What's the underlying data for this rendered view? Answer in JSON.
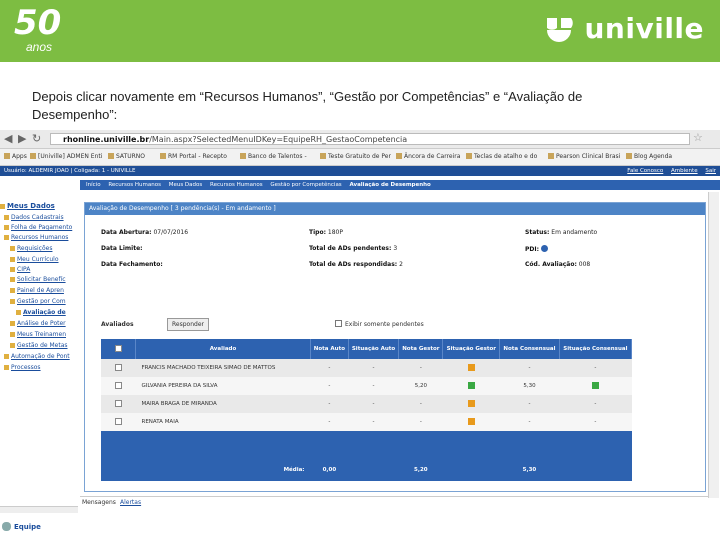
{
  "slide": {
    "logo_50": "50",
    "logo_anos": "anos",
    "brand": "univille",
    "caption": "Depois clicar novamente em “Recursos Humanos”, “Gestão por Competências” e “Avaliação de Desempenho”:",
    "colors": {
      "banner": "#7dbd42",
      "portal_blue": "#2d62b0",
      "panel_head": "#4d84c6"
    }
  },
  "browser": {
    "url_domain": "rhonline.univille.br",
    "url_path": "/Main.aspx?SelectedMenuIDKey=EquipeRH_GestaoCompetencia",
    "bookmarks": [
      "Apps",
      "[Univille] ADMEN Enti",
      "SATURNO",
      "RM Portal - Recepto",
      "Banco de Talentos -",
      "Teste Gratuito de Per",
      "Âncora de Carreira",
      "Teclas de atalho e do",
      "Pearson Clinical Brasi",
      "Blog Agenda"
    ]
  },
  "sysbar": {
    "user": "Usuário: ALDEMIR JOAO | Coligada: 1 - UNIVILLE",
    "fale": "Fale Conosco",
    "ambiente": "Ambiente",
    "sair": "Sair"
  },
  "menu": [
    "Início",
    "Recursos Humanos",
    "Meus Dados",
    "Recursos Humanos",
    "Gestão por Competências"
  ],
  "menu_current": "Avaliação de Desempenho",
  "tree": {
    "title": "Meus Dados",
    "items": [
      "Dados Cadastrais",
      "Folha de Pagamento",
      "Recursos Humanos",
      "Requisições",
      "Meu Currículo",
      "CIPA",
      "Solicitar Benefíc",
      "Painel de Apren",
      "Gestão por Com",
      "Avaliação de",
      "Análise de Poter",
      "Meus Treinamen",
      "Gestão de Metas",
      "Automação de Pont",
      "Processos"
    ],
    "equipe": "Equipe"
  },
  "panel": {
    "title": "Avaliação de Desempenho [ 3 pendência(s) - Em andamento ]",
    "fields": {
      "data_abertura_label": "Data Abertura:",
      "data_abertura": "07/07/2016",
      "tipo_label": "Tipo:",
      "tipo": "180P",
      "status_label": "Status:",
      "status": "Em andamento",
      "data_limite_label": "Data Limite:",
      "data_limite": "",
      "total_pend_label": "Total de ADs pendentes:",
      "total_pend": "3",
      "pdi_label": "PDI:",
      "data_fech_label": "Data Fechamento:",
      "data_fech": "",
      "total_resp_label": "Total de ADs respondidas:",
      "total_resp": "2",
      "cod_label": "Cód. Avaliação:",
      "cod": "008"
    },
    "avaliados_label": "Avaliados",
    "responder": "Responder",
    "somente_pendentes": "Exibir somente pendentes"
  },
  "table": {
    "headers": [
      "Avaliado",
      "Nota Auto",
      "Situação Auto",
      "Nota Gestor",
      "Situação Gestor",
      "Nota Consensual",
      "Situação Consensual"
    ],
    "rows": [
      {
        "name": "FRANCIS MACHADO TEIXEIRA SIMAO DE MATTOS",
        "nota_auto": "-",
        "sit_auto": "-",
        "nota_gestor": "-",
        "sit_gestor": "orange",
        "nota_cons": "-",
        "sit_cons": "-"
      },
      {
        "name": "GILVANIA PEREIRA DA SILVA",
        "nota_auto": "-",
        "sit_auto": "-",
        "nota_gestor": "5,20",
        "sit_gestor": "green",
        "nota_cons": "5,30",
        "sit_cons": "green"
      },
      {
        "name": "MAIRA BRAGA DE MIRANDA",
        "nota_auto": "-",
        "sit_auto": "-",
        "nota_gestor": "-",
        "sit_gestor": "orange",
        "nota_cons": "-",
        "sit_cons": "-"
      },
      {
        "name": "RENATA MAIA",
        "nota_auto": "-",
        "sit_auto": "-",
        "nota_gestor": "-",
        "sit_gestor": "orange",
        "nota_cons": "-",
        "sit_cons": "-"
      }
    ],
    "footer": {
      "label": "Média:",
      "auto": "0,00",
      "gestor": "5,20",
      "cons": "5,30"
    }
  },
  "tabs": {
    "mensagens": "Mensagens",
    "alertas": "Alertas"
  }
}
